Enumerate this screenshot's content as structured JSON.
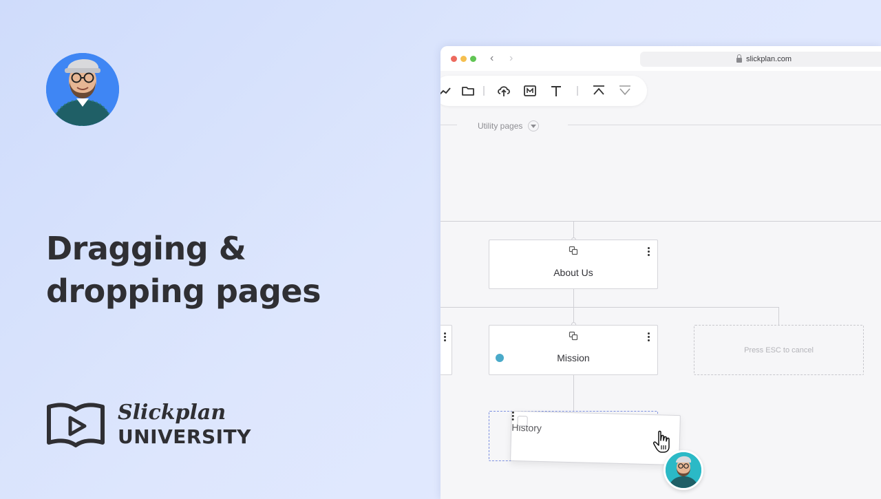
{
  "headline": {
    "line1": "Dragging &",
    "line2": "dropping pages"
  },
  "logo": {
    "script": "Slickplan",
    "university": "UNIVERSITY"
  },
  "browser": {
    "url": "slickplan.com"
  },
  "toolbar": {
    "tools": [
      "chart-icon",
      "folder-icon",
      "cloud-upload-icon",
      "markdown-icon",
      "text-icon",
      "collapse-up-icon",
      "expand-down-icon"
    ]
  },
  "sitemap": {
    "section_label": "Utility pages",
    "pages": [
      {
        "label": "About Us"
      },
      {
        "label": "Mission"
      },
      {
        "label": "History"
      }
    ],
    "ghost_hint": "Press ESC to cancel"
  },
  "colors": {
    "accent_blue": "#3f86f4",
    "status_teal": "#4aaac9",
    "drop_outline": "#7b8fe0"
  }
}
